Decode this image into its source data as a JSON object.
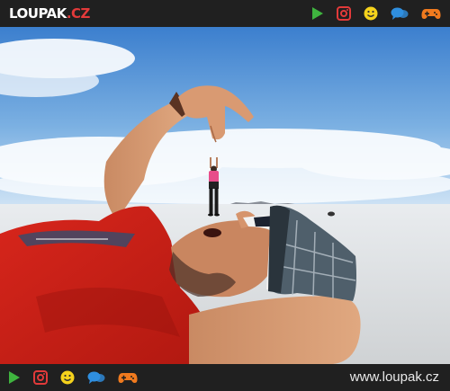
{
  "header": {
    "logo_main": "LOUPAK",
    "logo_tld": ".CZ",
    "icons": [
      "play-icon",
      "instagram-icon",
      "smiley-icon",
      "chat-icon",
      "gamepad-icon"
    ]
  },
  "footer": {
    "url_text": "www.loupak.cz",
    "icons": [
      "play-icon",
      "instagram-icon",
      "smiley-icon",
      "chat-icon",
      "gamepad-icon"
    ]
  },
  "colors": {
    "bar_bg": "#202020",
    "play": "#3fb43f",
    "instagram": "#e23a3a",
    "smiley": "#f5d21c",
    "chat": "#2f8fe0",
    "gamepad": "#f07a1e"
  }
}
